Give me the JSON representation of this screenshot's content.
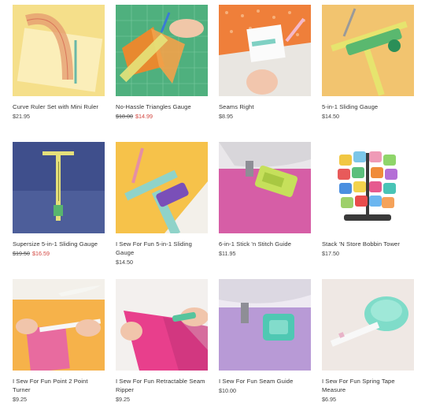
{
  "products": [
    {
      "title": "Curve Ruler Set with Mini Ruler",
      "price": "$21.95",
      "old_price": "",
      "sale_price": ""
    },
    {
      "title": "No-Hassle Triangles Gauge",
      "price": "",
      "old_price": "$18.00",
      "sale_price": "$14.99"
    },
    {
      "title": "Seams Right",
      "price": "$8.95",
      "old_price": "",
      "sale_price": ""
    },
    {
      "title": "5-in-1 Sliding Gauge",
      "price": "$14.50",
      "old_price": "",
      "sale_price": ""
    },
    {
      "title": "Supersize 5-in-1 Sliding Gauge",
      "price": "",
      "old_price": "$19.50",
      "sale_price": "$16.59"
    },
    {
      "title": "I Sew For Fun 5-in-1 Sliding Gauge",
      "price": "$14.50",
      "old_price": "",
      "sale_price": ""
    },
    {
      "title": "6-in-1 Stick 'n Stitch Guide",
      "price": "$11.95",
      "old_price": "",
      "sale_price": ""
    },
    {
      "title": "Stack 'N Store Bobbin Tower",
      "price": "$17.50",
      "old_price": "",
      "sale_price": ""
    },
    {
      "title": "I Sew For Fun Point 2 Point Turner",
      "price": "$9.25",
      "old_price": "",
      "sale_price": ""
    },
    {
      "title": "I Sew For Fun Retractable Seam Ripper",
      "price": "$9.25",
      "old_price": "",
      "sale_price": ""
    },
    {
      "title": "I Sew For Fun Seam Guide",
      "price": "$10.00",
      "old_price": "",
      "sale_price": ""
    },
    {
      "title": "I Sew For Fun Spring Tape Measure",
      "price": "$6.95",
      "old_price": "",
      "sale_price": ""
    }
  ],
  "colors": {
    "sale": "#d2453f",
    "text": "#333333"
  }
}
